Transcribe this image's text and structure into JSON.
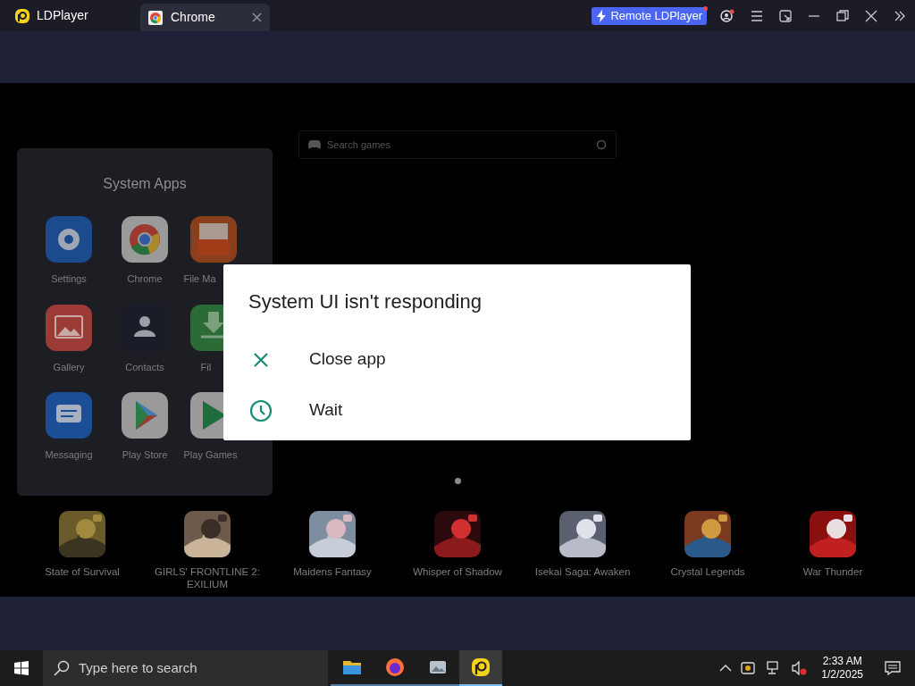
{
  "title_bar": {
    "app_name": "LDPlayer",
    "tabs": [
      {
        "label": "Chrome",
        "selected": true
      }
    ],
    "remote_button": "Remote LDPlayer"
  },
  "search": {
    "placeholder": "Search games"
  },
  "folder": {
    "title": "System Apps",
    "apps": [
      {
        "label": "Settings",
        "kind": "settings"
      },
      {
        "label": "Chrome",
        "kind": "chrome"
      },
      {
        "label": "File Ma",
        "kind": "filemanager"
      },
      {
        "label": "Gallery",
        "kind": "gallery"
      },
      {
        "label": "Contacts",
        "kind": "contacts"
      },
      {
        "label": "Fil",
        "kind": "files"
      },
      {
        "label": "Messaging",
        "kind": "messaging"
      },
      {
        "label": "Play Store",
        "kind": "playstore"
      },
      {
        "label": "Play Games",
        "kind": "playgames"
      }
    ]
  },
  "dialog": {
    "title": "System UI isn't responding",
    "actions": [
      {
        "kind": "close",
        "label": "Close app"
      },
      {
        "kind": "wait",
        "label": "Wait"
      }
    ]
  },
  "games": [
    {
      "label": "State of Survival"
    },
    {
      "label": "GIRLS' FRONTLINE 2: EXILIUM"
    },
    {
      "label": "Maidens Fantasy"
    },
    {
      "label": "Whisper of Shadow"
    },
    {
      "label": "Isekai Saga: Awaken"
    },
    {
      "label": "Crystal Legends"
    },
    {
      "label": "War Thunder"
    }
  ],
  "taskbar": {
    "search_placeholder": "Type here to search",
    "apps": [
      {
        "kind": "folder",
        "selected": false
      },
      {
        "kind": "firefox",
        "selected": false
      },
      {
        "kind": "photos",
        "selected": false
      },
      {
        "kind": "ldplayer",
        "selected": true
      }
    ],
    "time": "2:33 AM",
    "date": "1/2/2025"
  }
}
